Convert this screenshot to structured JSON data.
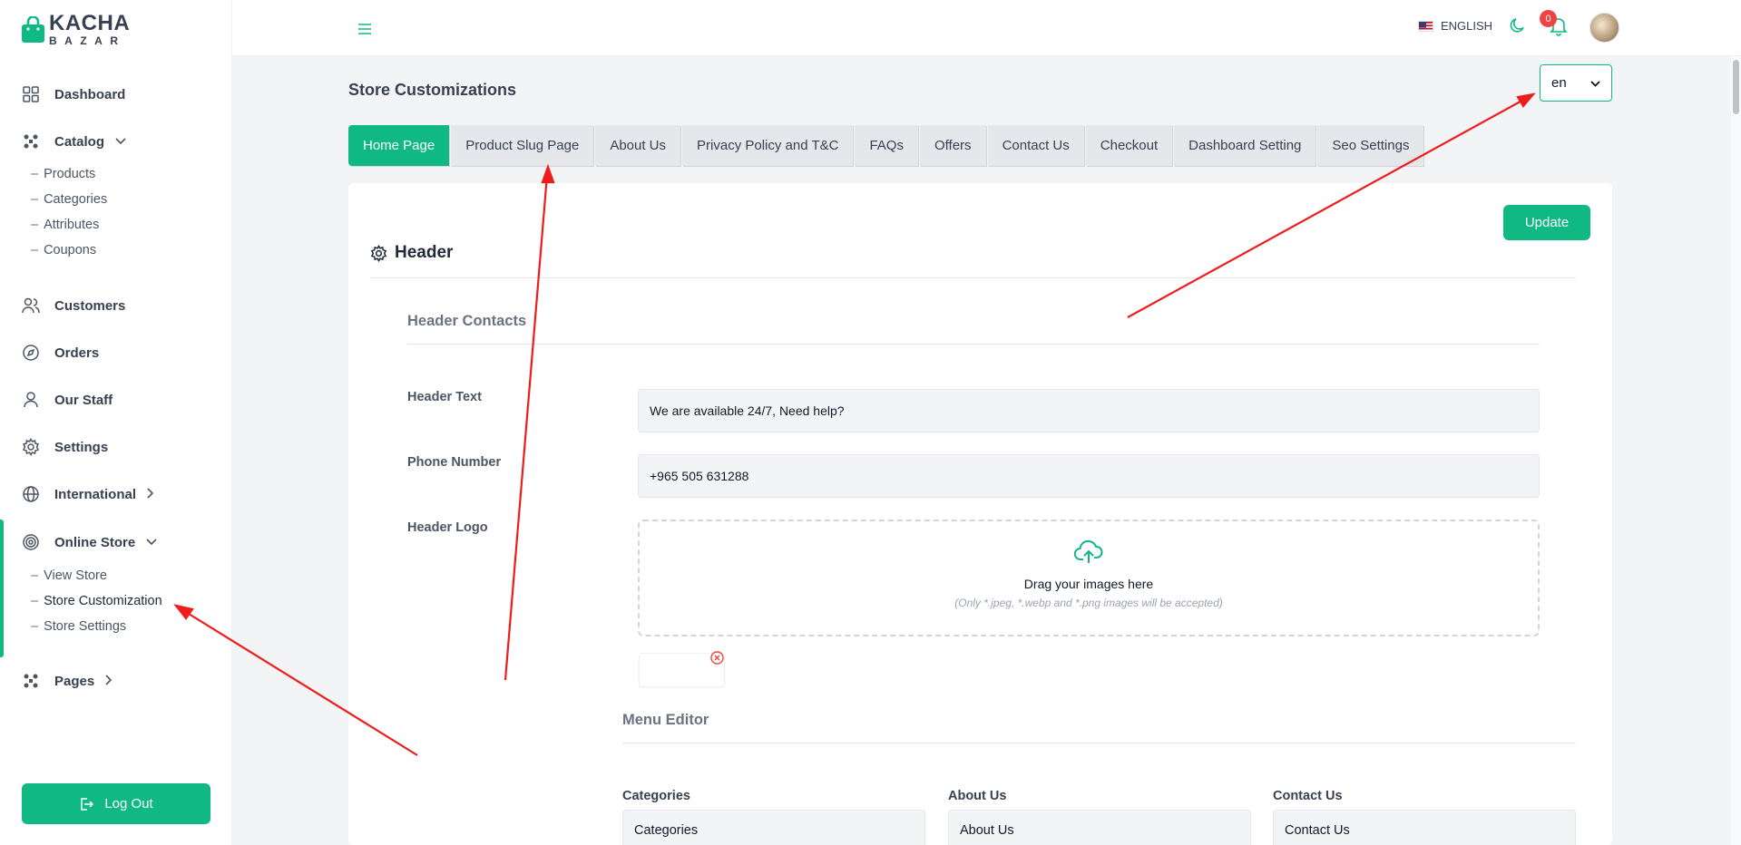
{
  "brand": {
    "line1": "KACHA",
    "line2": "BAZAR",
    "accent": "#10b981"
  },
  "sidebar": {
    "items": [
      {
        "label": "Dashboard",
        "icon": "grid-icon"
      },
      {
        "label": "Catalog",
        "icon": "catalog-icon",
        "expanded": true,
        "children": [
          "Products",
          "Categories",
          "Attributes",
          "Coupons"
        ]
      },
      {
        "label": "Customers",
        "icon": "users-icon"
      },
      {
        "label": "Orders",
        "icon": "compass-icon"
      },
      {
        "label": "Our Staff",
        "icon": "user-icon"
      },
      {
        "label": "Settings",
        "icon": "gear-icon"
      },
      {
        "label": "International",
        "icon": "globe-icon"
      },
      {
        "label": "Online Store",
        "icon": "target-icon",
        "expanded": true,
        "active": true,
        "children": [
          "View Store",
          "Store Customization",
          "Store Settings"
        ]
      },
      {
        "label": "Pages",
        "icon": "pages-icon"
      }
    ],
    "dash": "–",
    "logout": "Log Out"
  },
  "topbar": {
    "language": "ENGLISH",
    "notifications": "0"
  },
  "main": {
    "title": "Store Customizations",
    "lang_select": "en",
    "tabs": [
      "Home Page",
      "Product Slug Page",
      "About Us",
      "Privacy Policy and T&C",
      "FAQs",
      "Offers",
      "Contact Us",
      "Checkout",
      "Dashboard Setting",
      "Seo Settings"
    ],
    "update": "Update",
    "section": "Header",
    "subsection": "Header Contacts",
    "fields": {
      "header_text_label": "Header Text",
      "header_text_value": "We are available 24/7, Need help?",
      "phone_label": "Phone Number",
      "phone_value": "+965 505 631288",
      "logo_label": "Header Logo"
    },
    "dropzone": {
      "title": "Drag your images here",
      "hint": "(Only *.jpeg, *.webp and *.png images will be accepted)"
    },
    "menu_editor": {
      "title": "Menu Editor",
      "columns": [
        {
          "label": "Categories",
          "value": "Categories"
        },
        {
          "label": "About Us",
          "value": "About Us"
        },
        {
          "label": "Contact Us",
          "value": "Contact Us"
        }
      ]
    }
  }
}
